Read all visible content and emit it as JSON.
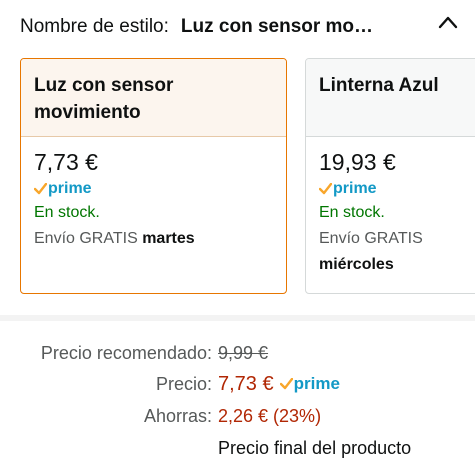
{
  "header": {
    "label": "Nombre de estilo:",
    "selected": "Luz con sensor mo…"
  },
  "options": [
    {
      "name": "Luz con sensor movimiento",
      "price": "7,73 €",
      "prime": "prime",
      "stock": "En stock.",
      "shipping_prefix": "Envío GRATIS",
      "shipping_day": "martes",
      "selected": true
    },
    {
      "name": "Linterna Azul",
      "price": "19,93 €",
      "prime": "prime",
      "stock": "En stock.",
      "shipping_prefix": "Envío GRATIS",
      "shipping_day": "miércoles",
      "selected": false
    }
  ],
  "pricing": {
    "recommended_label": "Precio recomendado:",
    "recommended_value": "9,99 €",
    "price_label": "Precio:",
    "price_value": "7,73 €",
    "prime": "prime",
    "savings_label": "Ahorras:",
    "savings_value": "2,26 € (23%)",
    "final_note": "Precio final del producto"
  },
  "colors": {
    "selected_border": "#e77600",
    "prime_blue": "#1399c6",
    "prime_check": "#f8a62b",
    "stock_green": "#007600",
    "price_red": "#b12704"
  }
}
